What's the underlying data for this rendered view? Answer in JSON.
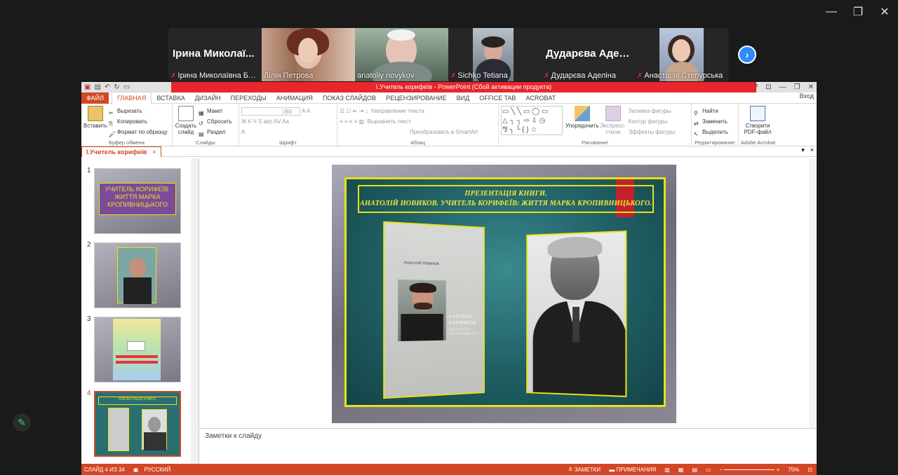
{
  "window": {
    "controls": [
      "—",
      "❐",
      "✕"
    ]
  },
  "participants": [
    {
      "bigname": "Ірина Миколаї...",
      "label": "Ірина Миколаївна Бог...",
      "muted": true
    },
    {
      "label": "Лілія Петрова",
      "muted": false
    },
    {
      "label": "anatoliy novykov",
      "muted": false,
      "active": true
    },
    {
      "label": "Sichko Tetiana",
      "muted": true
    },
    {
      "bigname": "Дударєва Адел...",
      "label": "Дударєва Аделіна",
      "muted": true
    },
    {
      "label": "Анастасія Степурська",
      "muted": true
    }
  ],
  "powerpoint": {
    "title": "І.Учитель корифеїв - PowerPoint (Сбой активации продукта)",
    "window_buttons": [
      "?",
      "⊡",
      "—",
      "❐",
      "✕"
    ],
    "tabs": [
      "ФАЙЛ",
      "ГЛАВНАЯ",
      "ВСТАВКА",
      "ДИЗАЙН",
      "ПЕРЕХОДЫ",
      "АНИМАЦИЯ",
      "ПОКАЗ СЛАЙДОВ",
      "РЕЦЕНЗИРОВАНИЕ",
      "ВИД",
      "OFFICE TAB",
      "ACROBAT"
    ],
    "login": "Вход",
    "ribbon": {
      "clipboard": {
        "paste": "Вставить",
        "cut": "Вырезать",
        "copy": "Копировать",
        "format": "Формат по образцу",
        "name": "Буфер обмена"
      },
      "slides": {
        "new": "Создать слайд",
        "layout": "Макет",
        "reset": "Сбросить",
        "section": "Раздел",
        "name": "Слайды"
      },
      "font": {
        "size": "60",
        "name": "Шрифт"
      },
      "paragraph": {
        "direction": "Направление текста",
        "align": "Выровнять текст",
        "smartart": "Преобразовать в SmartArt",
        "name": "Абзац"
      },
      "drawing": {
        "arrange": "Упорядочить",
        "styles": "Экспресс-стили",
        "fill": "Заливка фигуры",
        "outline": "Контур фигуры",
        "effects": "Эффекты фигуры",
        "name": "Рисование"
      },
      "editing": {
        "find": "Найти",
        "replace": "Заменить",
        "select": "Выделить",
        "name": "Редактирование"
      },
      "acrobat": {
        "create": "Створити PDF-файл",
        "name": "Adobe Acrobat"
      }
    },
    "doc_tab": "І.Учитель корифеїв",
    "thumbnails": [
      {
        "num": "1",
        "text": "УЧИТЕЛЬ КОРИФЕЇВ: ЖИТТЯ МАРКА КРОПИВНИЦЬКОГО"
      },
      {
        "num": "2"
      },
      {
        "num": "3"
      },
      {
        "num": "4",
        "text": "ПРЕЗЕНТАЦІЯ КНИГИ."
      }
    ],
    "slide": {
      "title_line1": "ПРЕЗЕНТАЦІЯ КНИГИ.",
      "title_line2": "АНАТОЛІЙ НОВИКОВ. УЧИТЕЛЬ КОРИФЕЇВ: ЖИТТЯ МАРКА КРОПИВНИЦЬКОГО.",
      "book_author": "Анатолій Новиков",
      "book_title": "УЧИТЕЛЬ КОРИФЕЇВ",
      "book_sub": "ЖИТТЯ МАРКА КРОПИВНИЦЬКОГО"
    },
    "notes_placeholder": "Заметки к слайду",
    "status": {
      "slide": "СЛАЙД 4 ИЗ 34",
      "lang": "РУССКИЙ",
      "notes": "ЗАМЕТКИ",
      "comments": "ПРИМЕЧАНИЯ",
      "zoom": "75%"
    }
  },
  "colors": {
    "accent": "#d24726",
    "zoom_active": "#23d959",
    "zoom_blue": "#2d8cff",
    "slide_yellow": "#e8e017"
  }
}
